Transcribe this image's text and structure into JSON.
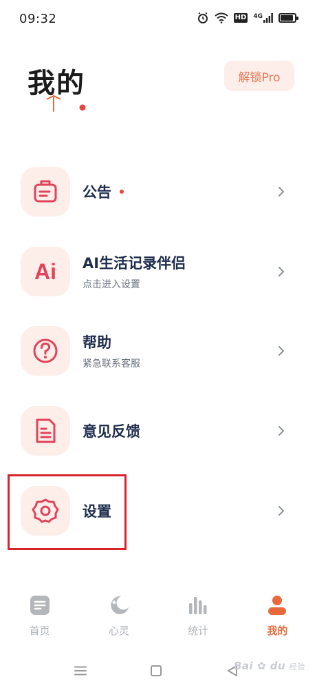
{
  "status_bar": {
    "time": "09:32",
    "icons": [
      "alarm-icon",
      "wifi-icon",
      "hd-icon",
      "signal-4g-icon",
      "battery-icon"
    ],
    "hd_label": "HD",
    "network_label": "4G"
  },
  "header": {
    "title": "我的",
    "unlock_label": "解锁Pro"
  },
  "menu": {
    "items": [
      {
        "label": "公告",
        "subtitle": "",
        "icon": "notice-board-icon",
        "has_dot": true
      },
      {
        "label": "AI生活记录伴侣",
        "subtitle": "点击进入设置",
        "icon": "ai-icon",
        "has_dot": false
      },
      {
        "label": "帮助",
        "subtitle": "紧急联系客服",
        "icon": "help-question-icon",
        "has_dot": false
      },
      {
        "label": "意见反馈",
        "subtitle": "",
        "icon": "feedback-document-icon",
        "has_dot": false
      },
      {
        "label": "设置",
        "subtitle": "",
        "icon": "settings-gear-icon",
        "has_dot": false
      }
    ],
    "ai_icon_text": "Ai"
  },
  "tabbar": {
    "tabs": [
      {
        "label": "首页",
        "icon": "home-list-icon",
        "active": false
      },
      {
        "label": "心灵",
        "icon": "moon-stars-icon",
        "active": false
      },
      {
        "label": "统计",
        "icon": "bar-chart-icon",
        "active": false
      },
      {
        "label": "我的",
        "icon": "person-icon",
        "active": true
      }
    ]
  },
  "watermark": {
    "brand": "Bai",
    "brand_suffix": "du",
    "sub": "经验"
  },
  "colors": {
    "accent": "#e8693b",
    "icon_red": "#e0435a",
    "icon_bg": "#fdeeea",
    "text_primary": "#1f2d4d",
    "highlight": "#d8232a"
  }
}
